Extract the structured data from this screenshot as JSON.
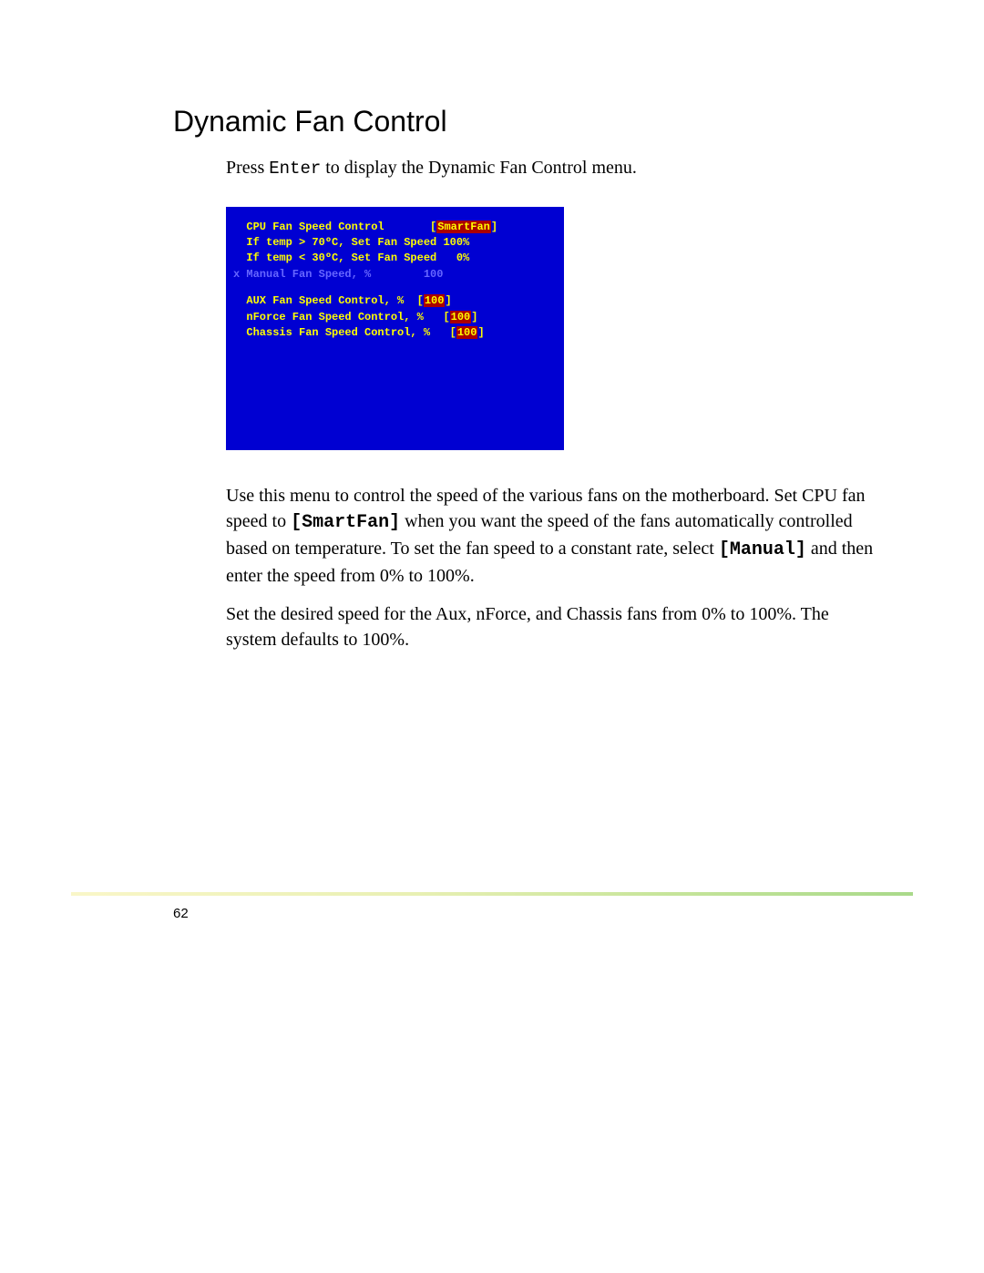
{
  "title": "Dynamic Fan Control",
  "intro_pre": "Press ",
  "intro_kbd": "Enter",
  "intro_post": " to display the Dynamic Fan Control menu.",
  "bios": {
    "l1_label": "  CPU Fan Speed Control       ",
    "l1_val": "SmartFan",
    "l2": "  If temp > 70ºC, Set Fan Speed 100%",
    "l3": "  If temp < 30ºC, Set Fan Speed   0%",
    "l4": "x Manual Fan Speed, %        100",
    "l5_label": "  AUX Fan Speed Control, %  ",
    "l5_val": "100",
    "l6_label": "  nForce Fan Speed Control, %   ",
    "l6_val": "100",
    "l7_label": "  Chassis Fan Speed Control, %   ",
    "l7_val": "100"
  },
  "para1_a": "Use this menu to control the speed of the various fans on the motherboard. Set CPU fan speed to ",
  "para1_sf": "[SmartFan]",
  "para1_b": " when you want the speed of the fans automatically controlled based on temperature. To set the fan speed to a constant rate, select ",
  "para1_man": "[Manual]",
  "para1_c": " and then enter the speed from 0% to 100%.",
  "para2": "Set the desired speed for the Aux, nForce, and Chassis fans from 0% to 100%. The system defaults to 100%.",
  "page_number": "62"
}
